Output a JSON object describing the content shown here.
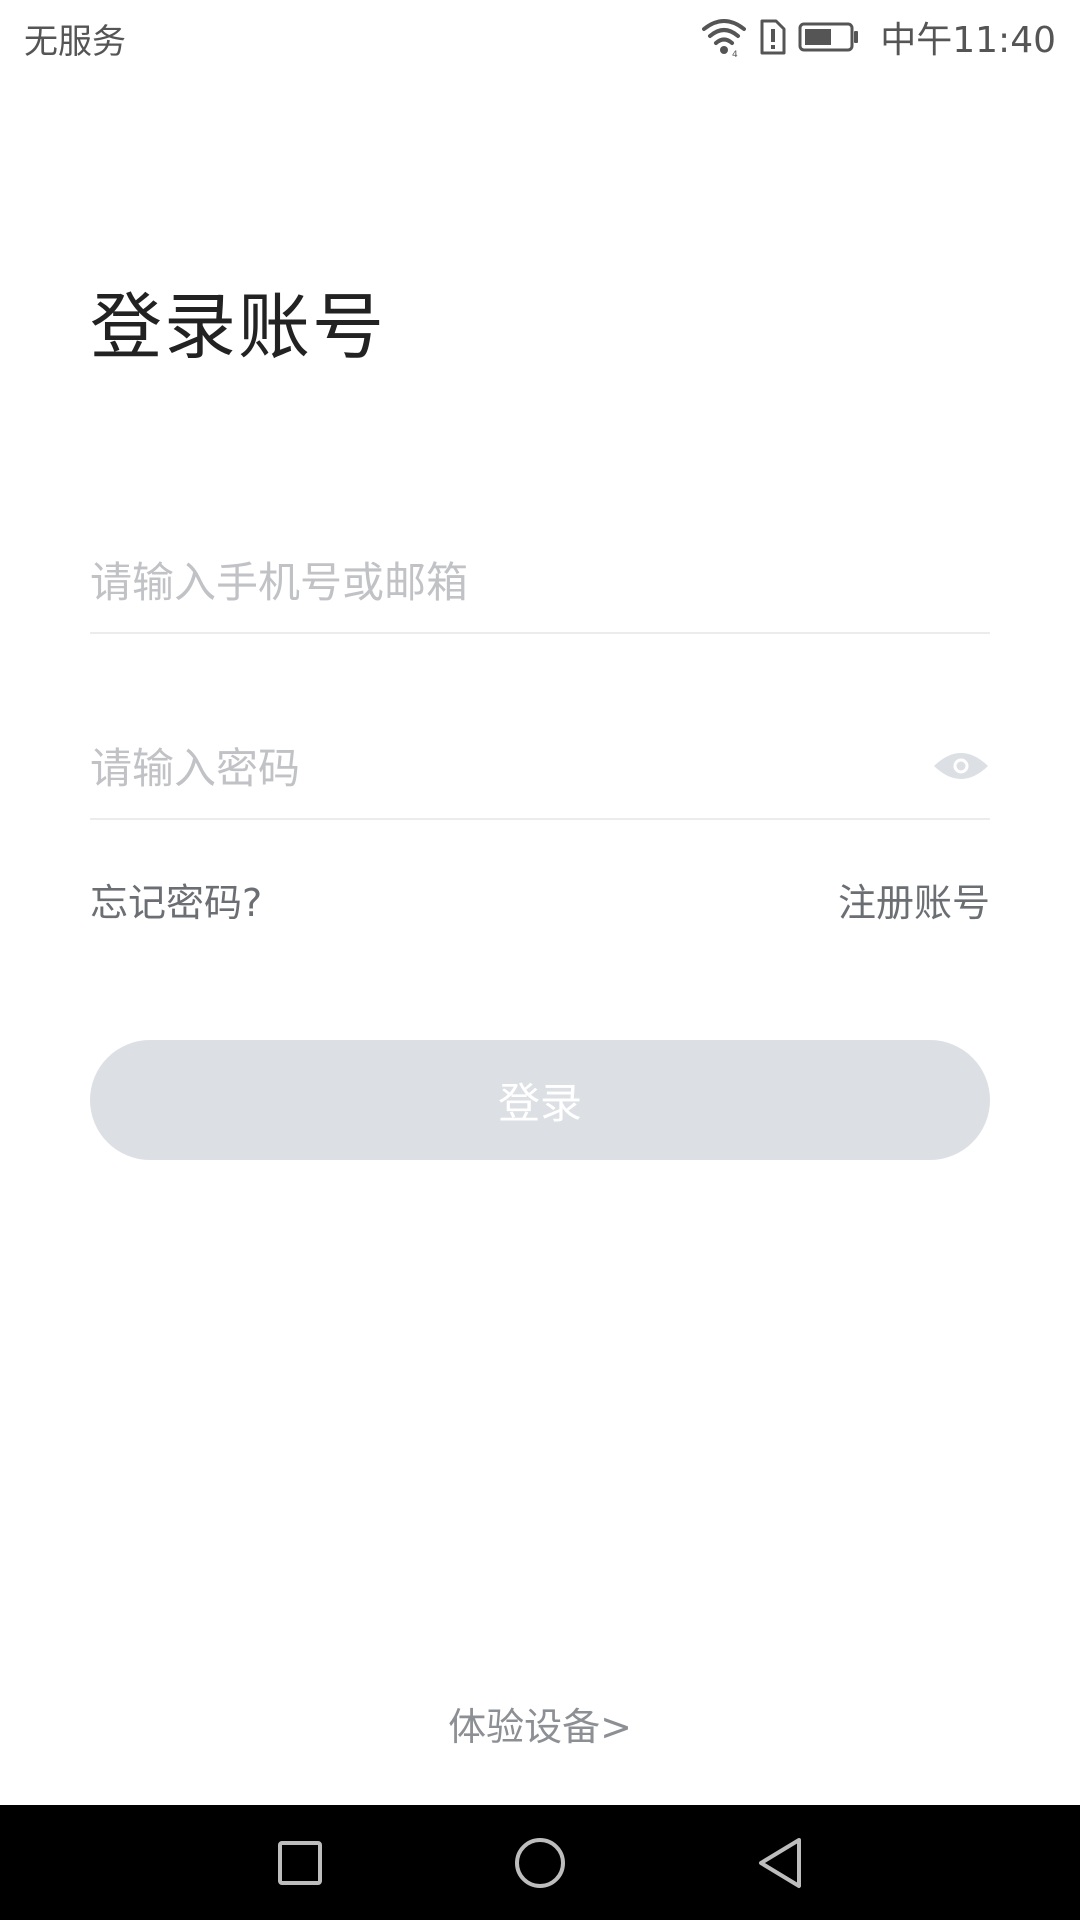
{
  "status_bar": {
    "carrier": "无服务",
    "time": "中午11:40",
    "icons": [
      "wifi-icon",
      "sim-alert-icon",
      "battery-icon"
    ]
  },
  "login": {
    "title": "登录账号",
    "account_placeholder": "请输入手机号或邮箱",
    "account_value": "",
    "password_placeholder": "请输入密码",
    "password_value": "",
    "forgot_password": "忘记密码?",
    "register": "注册账号",
    "submit": "登录",
    "demo_device": "体验设备>"
  },
  "nav_bar": {
    "icons": [
      "recent-apps-icon",
      "home-icon",
      "back-icon"
    ]
  },
  "colors": {
    "button_disabled": "#dcdfe3",
    "placeholder": "#c0c2c6",
    "link": "#6b6e73"
  }
}
